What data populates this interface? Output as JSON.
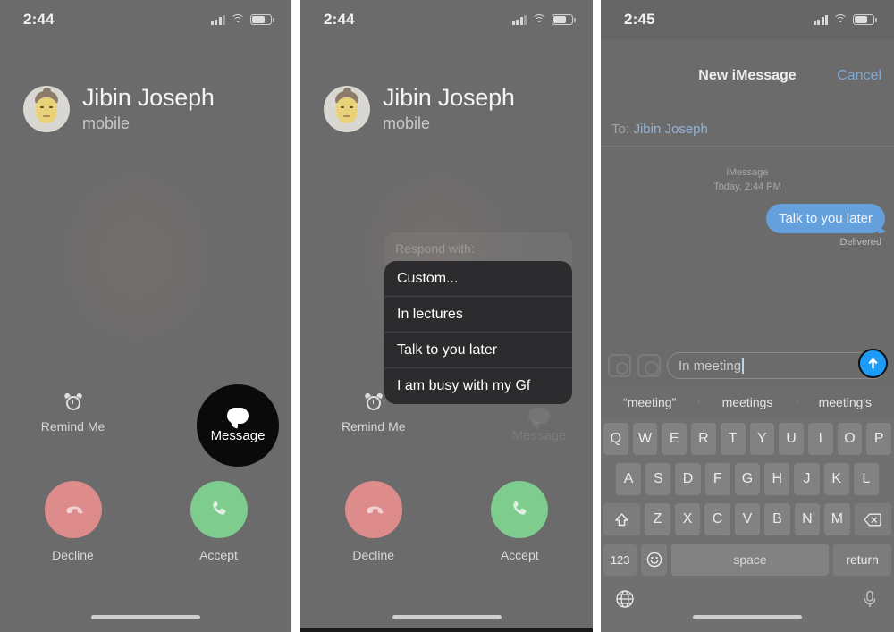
{
  "panels": [
    {
      "id": "incoming-call",
      "status": {
        "time": "2:44",
        "signal_icon": "cellular-signal-icon",
        "wifi_icon": "wifi-icon",
        "battery_icon": "battery-icon"
      },
      "caller": {
        "name": "Jibin Joseph",
        "label": "mobile",
        "avatar_icon": "memoji-avatar"
      },
      "actions": {
        "remind": {
          "label": "Remind Me",
          "icon": "alarm-clock-icon"
        },
        "message": {
          "label": "Message",
          "icon": "chat-bubble-icon"
        },
        "decline": {
          "label": "Decline",
          "icon": "phone-down-icon"
        },
        "accept": {
          "label": "Accept",
          "icon": "phone-icon"
        }
      }
    },
    {
      "id": "respond-with-sheet",
      "status": {
        "time": "2:44",
        "signal_icon": "cellular-signal-icon",
        "wifi_icon": "wifi-icon",
        "battery_icon": "battery-icon"
      },
      "caller": {
        "name": "Jibin Joseph",
        "label": "mobile",
        "avatar_icon": "memoji-avatar"
      },
      "sheet": {
        "header": "Respond with:",
        "options": [
          "Custom...",
          "In lectures",
          "Talk to you later",
          "I am busy with my Gf"
        ]
      },
      "actions": {
        "remind": {
          "label": "Remind Me",
          "icon": "alarm-clock-icon"
        },
        "message": {
          "label": "Message",
          "icon": "chat-bubble-icon"
        },
        "decline": {
          "label": "Decline",
          "icon": "phone-down-icon"
        },
        "accept": {
          "label": "Accept",
          "icon": "phone-icon"
        }
      }
    },
    {
      "id": "new-imessage",
      "status": {
        "time": "2:45",
        "signal_icon": "cellular-signal-icon",
        "wifi_icon": "wifi-icon",
        "battery_icon": "battery-icon"
      },
      "nav": {
        "title": "New iMessage",
        "cancel": "Cancel"
      },
      "to": {
        "label": "To:",
        "value": "Jibin Joseph"
      },
      "thread": {
        "service": "iMessage",
        "timestamp": "Today, 2:44 PM",
        "bubble": "Talk to you later",
        "receipt": "Delivered"
      },
      "compose": {
        "camera_icon": "camera-icon",
        "apps_icon": "app-store-icon",
        "value": "In meeting",
        "send_icon": "send-arrow-up-icon"
      },
      "suggestions": [
        "“meeting”",
        "meetings",
        "meeting's"
      ],
      "keyboard": {
        "row1": [
          "Q",
          "W",
          "E",
          "R",
          "T",
          "Y",
          "U",
          "I",
          "O",
          "P"
        ],
        "row2": [
          "A",
          "S",
          "D",
          "F",
          "G",
          "H",
          "J",
          "K",
          "L"
        ],
        "row3": [
          "Z",
          "X",
          "C",
          "V",
          "B",
          "N",
          "M"
        ],
        "shift_icon": "shift-arrow-icon",
        "delete_icon": "backspace-icon",
        "numbers_key": "123",
        "emoji_icon": "emoji-smiley-icon",
        "space_key": "space",
        "return_key": "return",
        "globe_icon": "globe-icon",
        "mic_icon": "microphone-icon"
      }
    }
  ],
  "colors": {
    "accept_green": "#7fcd8e",
    "decline_red": "#dd8b8b",
    "message_black": "#0a0a0a",
    "bubble_blue": "#64a0dc",
    "send_blue": "#1d9bf6",
    "menu_dark": "#2c2c2e",
    "screen_gray": "#6b6b6b"
  }
}
